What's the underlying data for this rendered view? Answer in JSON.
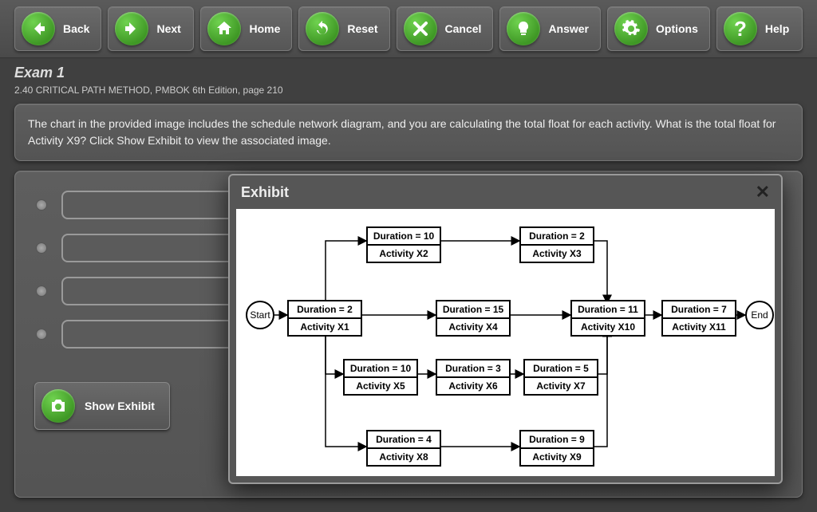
{
  "toolbar": {
    "back": "Back",
    "next": "Next",
    "home": "Home",
    "reset": "Reset",
    "cancel": "Cancel",
    "answer": "Answer",
    "options": "Options",
    "help": "Help"
  },
  "exam": {
    "title": "Exam 1",
    "subtitle": "2.40 CRITICAL PATH METHOD, PMBOK 6th Edition, page 210",
    "question": "The chart in the provided image includes the schedule network diagram, and you are calculating the total float for each activity. What is the total float for Activity X9? Click Show Exhibit to view the associated image.",
    "show_exhibit": "Show Exhibit"
  },
  "modal": {
    "title": "Exhibit"
  },
  "diagram": {
    "start": "Start",
    "end": "End",
    "dur_label": "Duration = ",
    "act_label": "Activity ",
    "activities": {
      "x1": {
        "name": "X1",
        "duration": 2
      },
      "x2": {
        "name": "X2",
        "duration": 10
      },
      "x3": {
        "name": "X3",
        "duration": 2
      },
      "x4": {
        "name": "X4",
        "duration": 15
      },
      "x5": {
        "name": "X5",
        "duration": 10
      },
      "x6": {
        "name": "X6",
        "duration": 3
      },
      "x7": {
        "name": "X7",
        "duration": 5
      },
      "x8": {
        "name": "X8",
        "duration": 4
      },
      "x9": {
        "name": "X9",
        "duration": 9
      },
      "x10": {
        "name": "X10",
        "duration": 11
      },
      "x11": {
        "name": "X11",
        "duration": 7
      }
    }
  }
}
